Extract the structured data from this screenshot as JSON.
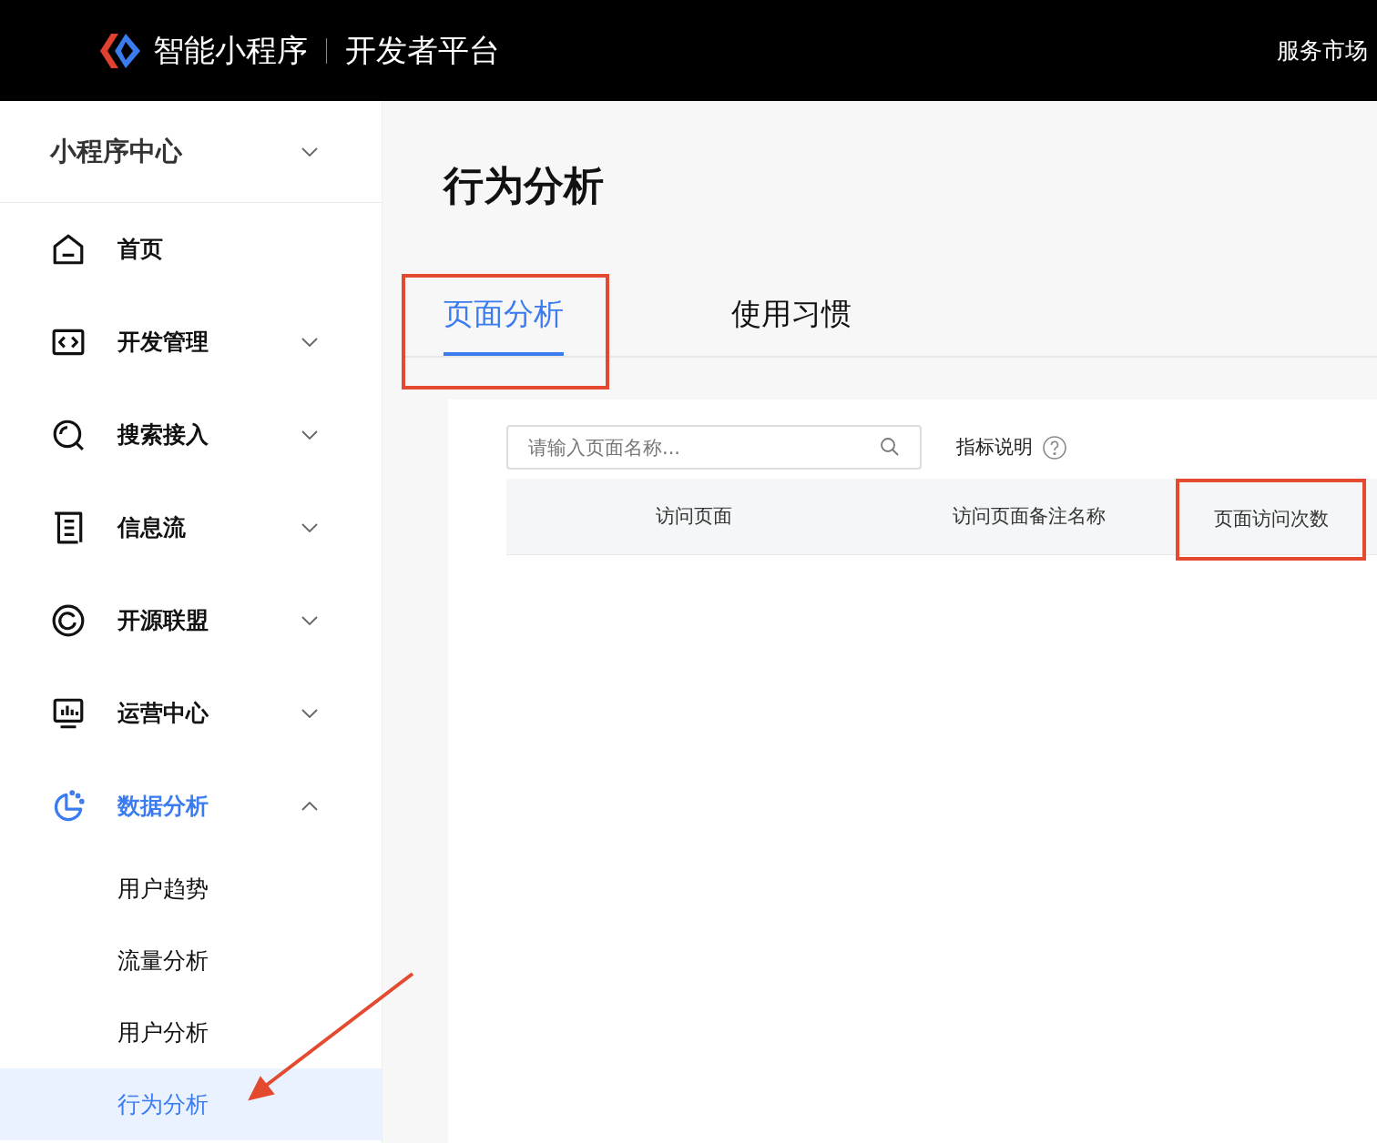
{
  "header": {
    "product": "智能小程序",
    "platform": "开发者平台",
    "market_link": "服务市场"
  },
  "sidebar": {
    "app_center": {
      "label": "小程序中心",
      "expanded": false
    },
    "items": [
      {
        "label": "首页",
        "kind": "home",
        "active": false
      },
      {
        "label": "开发管理",
        "kind": "code",
        "active": false,
        "expanded": false
      },
      {
        "label": "搜索接入",
        "kind": "search",
        "active": false,
        "expanded": false
      },
      {
        "label": "信息流",
        "kind": "feed",
        "active": false,
        "expanded": false
      },
      {
        "label": "开源联盟",
        "kind": "ring",
        "active": false,
        "expanded": false
      },
      {
        "label": "运营中心",
        "kind": "monitor",
        "active": false,
        "expanded": false
      },
      {
        "label": "数据分析",
        "kind": "pie",
        "active": true,
        "expanded": true,
        "children": [
          {
            "label": "用户趋势",
            "selected": false,
            "pointer": false
          },
          {
            "label": "流量分析",
            "selected": false,
            "pointer": false
          },
          {
            "label": "用户分析",
            "selected": false,
            "pointer": false
          },
          {
            "label": "行为分析",
            "selected": true,
            "pointer": true
          }
        ]
      }
    ]
  },
  "page_title": "行为分析",
  "tabs": [
    {
      "label": "页面分析",
      "selected": true,
      "highlighted": true
    },
    {
      "label": "使用习惯",
      "selected": false,
      "highlighted": false
    }
  ],
  "search": {
    "placeholder": "请输入页面名称..."
  },
  "metrics_help": "指标说明",
  "table": {
    "columns": [
      {
        "label": "访问页面",
        "highlighted": false
      },
      {
        "label": "访问页面备注名称",
        "highlighted": false
      },
      {
        "label": "页面访问次数",
        "highlighted": true
      }
    ]
  }
}
